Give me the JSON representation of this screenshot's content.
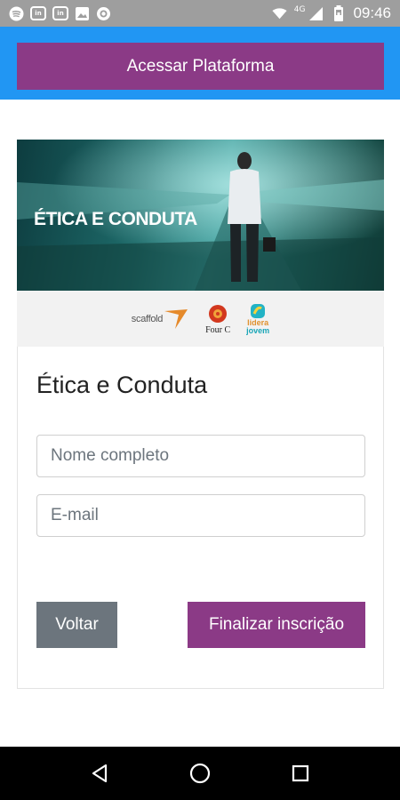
{
  "status_bar": {
    "time": "09:46",
    "network_type": "4G",
    "icons": [
      "spotify-icon",
      "linkedin-icon",
      "linkedin-icon",
      "image-icon",
      "circle-app-icon",
      "wifi-icon",
      "signal-icon",
      "battery-icon"
    ],
    "notif_label_1": "in",
    "notif_label_2": "in"
  },
  "top_bar": {
    "access_button_label": "Acessar Plataforma",
    "colors": {
      "bar": "#2196f3",
      "button": "#8b3a86"
    }
  },
  "banner": {
    "title": "ÉTICA E CONDUTA"
  },
  "sponsors": {
    "logos": [
      {
        "name": "scaffold",
        "text": "scaffold"
      },
      {
        "name": "fourc",
        "text": "Four C"
      },
      {
        "name": "lidera-jovem",
        "text_line1": "lidera",
        "text_line2": "jovem"
      }
    ]
  },
  "form": {
    "title": "Ética e Conduta",
    "name_placeholder": "Nome completo",
    "email_placeholder": "E-mail",
    "back_label": "Voltar",
    "finish_label": "Finalizar inscrição",
    "colors": {
      "back": "#6c757d",
      "finish": "#8b3a86"
    }
  },
  "nav_bar": {
    "icons": [
      "back-icon",
      "home-icon",
      "recents-icon"
    ]
  }
}
